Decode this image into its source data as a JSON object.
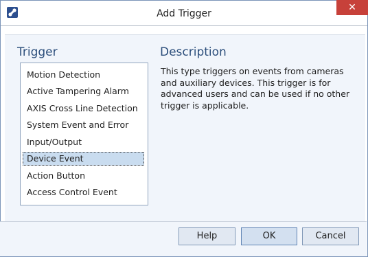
{
  "window": {
    "title": "Add Trigger",
    "close_glyph": "✕",
    "icon": "plugin-icon"
  },
  "trigger": {
    "heading": "Trigger",
    "items": [
      "Motion Detection",
      "Active Tampering Alarm",
      "AXIS Cross Line Detection",
      "System Event and Error",
      "Input/Output",
      "Device Event",
      "Action Button",
      "Access Control Event"
    ],
    "selected": "Device Event"
  },
  "description": {
    "heading": "Description",
    "text": "This type triggers on events from cameras and auxiliary devices. This trigger is for advanced users and can be used if no other trigger is applicable."
  },
  "buttons": {
    "help": "Help",
    "ok": "OK",
    "cancel": "Cancel"
  },
  "colors": {
    "accent": "#2d4f7c",
    "close": "#c7413a",
    "selection": "#c9dcef"
  }
}
